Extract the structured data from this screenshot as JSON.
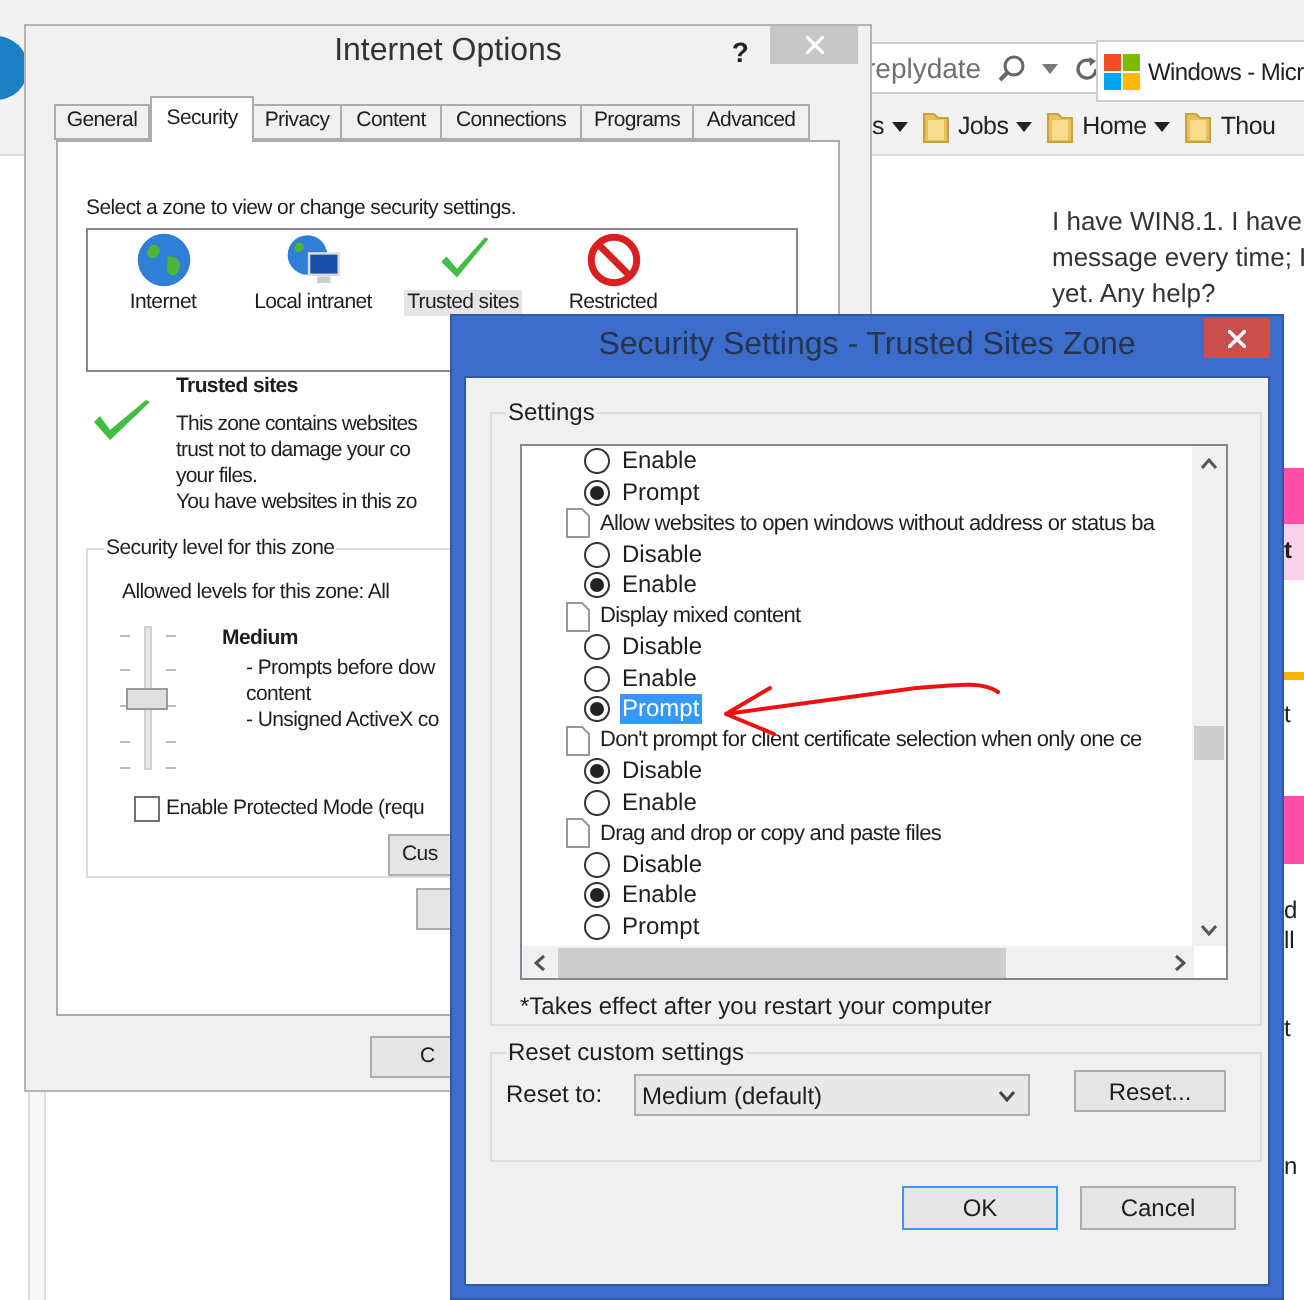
{
  "browser": {
    "address_text": "replydate",
    "tab_title": "Windows - Micr",
    "favorites": [
      {
        "kind": "text",
        "label": "s",
        "menu": true
      },
      {
        "kind": "folder",
        "label": "Jobs",
        "menu": true
      },
      {
        "kind": "folder",
        "label": "Home",
        "menu": true
      },
      {
        "kind": "folder",
        "label": "Thou",
        "menu": false
      }
    ],
    "post_lines": [
      "I have WIN8.1.  I have",
      "message every time;  I",
      "yet.  Any help?"
    ],
    "page_fragments": [
      "t",
      "t",
      "d",
      "ll",
      "t",
      "n"
    ]
  },
  "internet_options": {
    "title": "Internet Options",
    "help": "?",
    "tabs": [
      {
        "label": "General",
        "selected": false
      },
      {
        "label": "Security",
        "selected": true
      },
      {
        "label": "Privacy",
        "selected": false
      },
      {
        "label": "Content",
        "selected": false
      },
      {
        "label": "Connections",
        "selected": false
      },
      {
        "label": "Programs",
        "selected": false
      },
      {
        "label": "Advanced",
        "selected": false
      }
    ],
    "zone_prompt": "Select a zone to view or change security settings.",
    "zones": [
      {
        "kind": "globe",
        "label": "Internet",
        "selected": false
      },
      {
        "kind": "intranet",
        "label": "Local intranet",
        "selected": false
      },
      {
        "kind": "trusted",
        "label": "Trusted sites",
        "selected": true
      },
      {
        "kind": "restricted",
        "label": "Restricted",
        "selected": false
      }
    ],
    "zone_name": "Trusted sites",
    "zone_description": [
      "This zone contains websites",
      "trust not to damage your co",
      "your files.",
      "You have websites in this zo"
    ],
    "security_level": {
      "legend": "Security level for this zone",
      "allowed": "Allowed levels for this zone: All",
      "level": 0.5,
      "level_name": "Medium",
      "details": [
        "- Prompts before dow",
        "content",
        "- Unsigned ActiveX co"
      ]
    },
    "protected_mode": {
      "label": "Enable Protected Mode (requ",
      "checked": false
    },
    "custom_button": "Cus",
    "bottom_button": "C"
  },
  "security_settings": {
    "title": "Security Settings - Trusted Sites Zone",
    "settings_legend": "Settings",
    "items": [
      {
        "kind": "option",
        "label": "Enable",
        "checked": false,
        "highlighted": false
      },
      {
        "kind": "option",
        "label": "Prompt",
        "checked": true,
        "highlighted": false
      },
      {
        "kind": "setting",
        "label": "Allow websites to open windows without address or status ba"
      },
      {
        "kind": "option",
        "label": "Disable",
        "checked": false,
        "highlighted": false
      },
      {
        "kind": "option",
        "label": "Enable",
        "checked": true,
        "highlighted": false
      },
      {
        "kind": "setting",
        "label": "Display mixed content"
      },
      {
        "kind": "option",
        "label": "Disable",
        "checked": false,
        "highlighted": false
      },
      {
        "kind": "option",
        "label": "Enable",
        "checked": false,
        "highlighted": false
      },
      {
        "kind": "option",
        "label": "Prompt",
        "checked": true,
        "highlighted": true
      },
      {
        "kind": "setting",
        "label": "Don't prompt for client certificate selection when only one ce"
      },
      {
        "kind": "option",
        "label": "Disable",
        "checked": true,
        "highlighted": false
      },
      {
        "kind": "option",
        "label": "Enable",
        "checked": false,
        "highlighted": false
      },
      {
        "kind": "setting",
        "label": "Drag and drop or copy and paste files"
      },
      {
        "kind": "option",
        "label": "Disable",
        "checked": false,
        "highlighted": false
      },
      {
        "kind": "option",
        "label": "Enable",
        "checked": true,
        "highlighted": false
      },
      {
        "kind": "option",
        "label": "Prompt",
        "checked": false,
        "highlighted": false
      }
    ],
    "footnote": "*Takes effect after you restart your computer",
    "reset": {
      "legend": "Reset custom settings",
      "label": "Reset to:",
      "value": "Medium (default)",
      "button": "Reset..."
    },
    "buttons": [
      {
        "label": "OK",
        "focused": true
      },
      {
        "label": "Cancel",
        "focused": false
      }
    ]
  }
}
